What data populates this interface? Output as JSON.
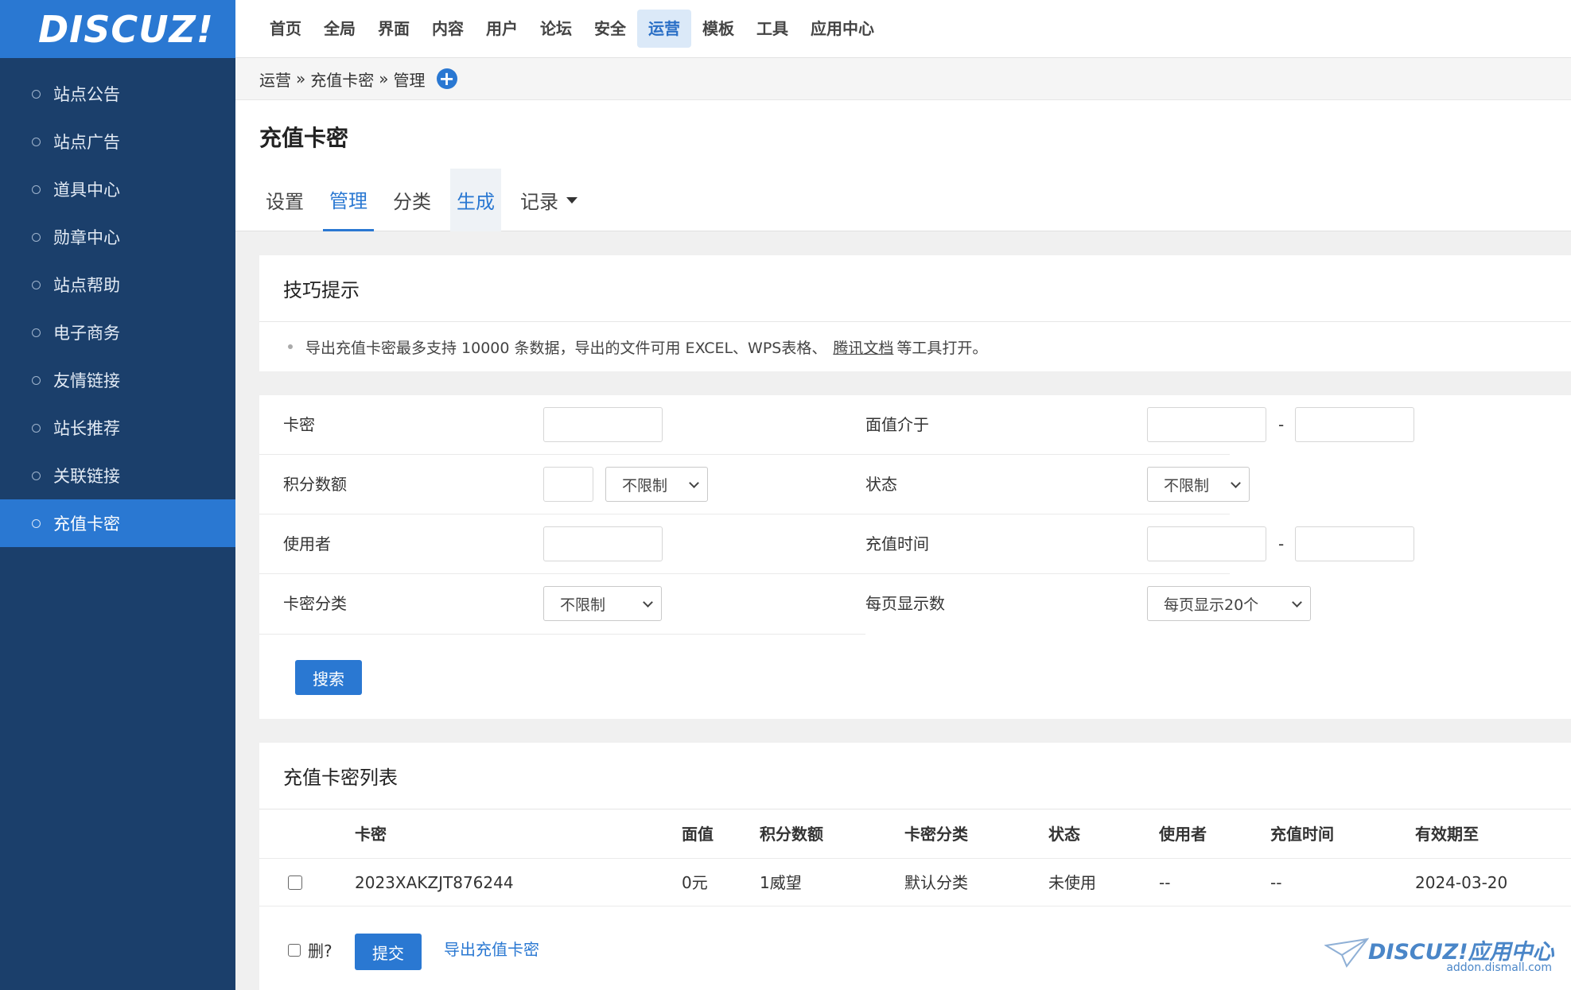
{
  "logo": {
    "text": "DISCUZ!"
  },
  "sidebar": {
    "items": [
      {
        "label": "站点公告"
      },
      {
        "label": "站点广告"
      },
      {
        "label": "道具中心"
      },
      {
        "label": "勋章中心"
      },
      {
        "label": "站点帮助"
      },
      {
        "label": "电子商务"
      },
      {
        "label": "友情链接"
      },
      {
        "label": "站长推荐"
      },
      {
        "label": "关联链接"
      },
      {
        "label": "充值卡密",
        "active": true
      }
    ]
  },
  "topnav": {
    "items": [
      "首页",
      "全局",
      "界面",
      "内容",
      "用户",
      "论坛",
      "安全",
      "运营",
      "模板",
      "工具",
      "应用中心"
    ],
    "active_index": 7
  },
  "breadcrumb": {
    "part1": "运营",
    "part2": "充值卡密",
    "part3": "管理",
    "sep": "»",
    "add_icon": "plus-circle-icon"
  },
  "page": {
    "title": "充值卡密",
    "tabs": [
      "设置",
      "管理",
      "分类",
      "生成",
      "记录"
    ],
    "active_tab": 1
  },
  "tips": {
    "title": "技巧提示",
    "text_before": "导出充值卡密最多支持 10000 条数据，导出的文件可用 EXCEL、WPS表格、",
    "link": "腾讯文档",
    "text_after": "等工具打开。"
  },
  "search": {
    "card_label": "卡密",
    "value_range_label": "面值介于",
    "credit_label": "积分数额",
    "credit_select": "不限制",
    "status_label": "状态",
    "status_select": "不限制",
    "user_label": "使用者",
    "time_label": "充值时间",
    "category_label": "卡密分类",
    "category_select": "不限制",
    "perpage_label": "每页显示数",
    "perpage_select": "每页显示20个",
    "range_sep": "-",
    "button": "搜索"
  },
  "list": {
    "title": "充值卡密列表",
    "columns": [
      "卡密",
      "面值",
      "积分数额",
      "卡密分类",
      "状态",
      "使用者",
      "充值时间",
      "有效期至"
    ],
    "rows": [
      [
        "2023XAKZJT876244",
        "0元",
        "1威望",
        "默认分类",
        "未使用",
        "--",
        "--",
        "2024-03-20"
      ]
    ],
    "delete_label": "删?",
    "submit": "提交",
    "export": "导出充值卡密"
  },
  "watermark": {
    "text": "DISCUZ!应用中心",
    "sub": "addon.dismall.com"
  },
  "colors": {
    "sidebar_bg": "#1b3f6b",
    "accent": "#2a78d2"
  }
}
